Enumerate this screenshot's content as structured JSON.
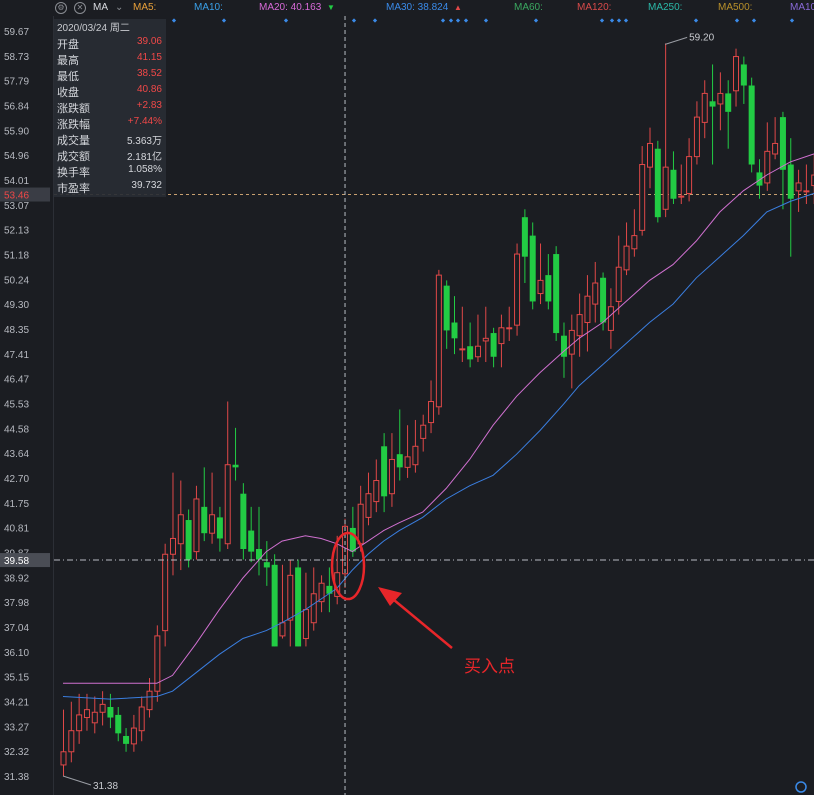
{
  "toolbar": {
    "settings_icon": "gear-icon",
    "close_icon": "close-icon",
    "indicator": "MA",
    "ma5": {
      "label": "MA5:",
      "color": "#e8a03a"
    },
    "ma10": {
      "label": "MA10:",
      "color": "#3aa0e8"
    },
    "ma20": {
      "label": "MA20: 40.163",
      "color": "#d86ad8"
    },
    "ma30": {
      "label": "MA30: 38.824",
      "color": "#3a8ae8"
    },
    "ma60": {
      "label": "MA60:",
      "color": "#3aa860"
    },
    "ma120": {
      "label": "MA120:",
      "color": "#d84a4a"
    },
    "ma250": {
      "label": "MA250:",
      "color": "#2ab8a8"
    },
    "ma500": {
      "label": "MA500:",
      "color": "#b8902a"
    },
    "ma_more": {
      "label": "MA10",
      "color": "#8a6ad8"
    }
  },
  "info_panel": {
    "date": "2020/03/24 周二",
    "rows": [
      {
        "label": "开盘",
        "value": "39.06",
        "tone": "up"
      },
      {
        "label": "最高",
        "value": "41.15",
        "tone": "up"
      },
      {
        "label": "最低",
        "value": "38.52",
        "tone": "up"
      },
      {
        "label": "收盘",
        "value": "40.86",
        "tone": "up"
      },
      {
        "label": "涨跌额",
        "value": "+2.83",
        "tone": "up"
      },
      {
        "label": "涨跌幅",
        "value": "+7.44%",
        "tone": "up"
      },
      {
        "label": "成交量",
        "value": "5.363万",
        "tone": "neu"
      },
      {
        "label": "成交额",
        "value": "2.181亿",
        "tone": "neu"
      },
      {
        "label": "换手率",
        "value": "1.058%",
        "tone": "neu"
      },
      {
        "label": "市盈率",
        "value": "39.732",
        "tone": "neu"
      }
    ]
  },
  "colors": {
    "background": "#1b1d22",
    "up": "#e04848",
    "down": "#22cc44",
    "ma20": "#d070d0",
    "ma30": "#3a7ee0",
    "crosshair": "#b8bcc4",
    "dash_price": "#c8a070",
    "annotation": "#e8262a"
  },
  "chart_data": {
    "type": "candlestick",
    "y_ticks": [
      "59.67",
      "58.73",
      "57.79",
      "56.84",
      "55.90",
      "54.96",
      "54.01",
      "53.07",
      "52.13",
      "51.18",
      "50.24",
      "49.30",
      "48.35",
      "47.41",
      "46.47",
      "45.53",
      "44.58",
      "43.64",
      "42.70",
      "41.75",
      "40.81",
      "39.87",
      "38.92",
      "37.98",
      "37.04",
      "36.10",
      "35.15",
      "34.21",
      "33.27",
      "32.32",
      "31.38"
    ],
    "ylim": [
      31.38,
      59.67
    ],
    "high_label": "59.20",
    "low_label": "31.38",
    "hline_price": {
      "value": 53.46,
      "label": "53.46"
    },
    "crosshair_price": {
      "value": 39.58,
      "label": "39.58"
    },
    "crosshair_index": 36,
    "annotation": "买入点",
    "candles": [
      {
        "o": 31.8,
        "c": 32.3,
        "h": 33.9,
        "l": 31.38
      },
      {
        "o": 32.3,
        "c": 33.1,
        "h": 34.2,
        "l": 31.9
      },
      {
        "o": 33.1,
        "c": 33.7,
        "h": 34.5,
        "l": 32.6
      },
      {
        "o": 33.6,
        "c": 33.9,
        "h": 34.5,
        "l": 33.1
      },
      {
        "o": 33.4,
        "c": 33.8,
        "h": 34.4,
        "l": 33.0
      },
      {
        "o": 33.8,
        "c": 34.1,
        "h": 34.6,
        "l": 33.3
      },
      {
        "o": 34.0,
        "c": 33.6,
        "h": 34.5,
        "l": 33.2
      },
      {
        "o": 33.7,
        "c": 33.0,
        "h": 34.0,
        "l": 32.7
      },
      {
        "o": 32.9,
        "c": 32.6,
        "h": 33.2,
        "l": 32.3
      },
      {
        "o": 32.6,
        "c": 33.2,
        "h": 33.7,
        "l": 32.3
      },
      {
        "o": 33.1,
        "c": 34.0,
        "h": 34.4,
        "l": 32.7
      },
      {
        "o": 33.9,
        "c": 34.6,
        "h": 35.1,
        "l": 33.6
      },
      {
        "o": 34.6,
        "c": 36.7,
        "h": 37.1,
        "l": 34.2
      },
      {
        "o": 36.9,
        "c": 39.8,
        "h": 40.2,
        "l": 36.3
      },
      {
        "o": 39.8,
        "c": 40.4,
        "h": 42.9,
        "l": 39.0
      },
      {
        "o": 40.2,
        "c": 41.3,
        "h": 42.6,
        "l": 39.2
      },
      {
        "o": 41.1,
        "c": 39.6,
        "h": 41.5,
        "l": 39.3
      },
      {
        "o": 39.9,
        "c": 41.9,
        "h": 42.4,
        "l": 39.6
      },
      {
        "o": 41.6,
        "c": 40.6,
        "h": 43.1,
        "l": 40.3
      },
      {
        "o": 40.6,
        "c": 41.3,
        "h": 42.9,
        "l": 40.2
      },
      {
        "o": 41.2,
        "c": 40.4,
        "h": 41.6,
        "l": 39.9
      },
      {
        "o": 40.2,
        "c": 43.2,
        "h": 45.6,
        "l": 40.0
      },
      {
        "o": 43.2,
        "c": 43.1,
        "h": 44.6,
        "l": 42.6
      },
      {
        "o": 42.1,
        "c": 40.0,
        "h": 42.5,
        "l": 39.6
      },
      {
        "o": 40.7,
        "c": 39.9,
        "h": 41.6,
        "l": 39.5
      },
      {
        "o": 40.0,
        "c": 39.6,
        "h": 41.6,
        "l": 39.0
      },
      {
        "o": 39.5,
        "c": 39.3,
        "h": 40.3,
        "l": 38.6
      },
      {
        "o": 39.4,
        "c": 36.3,
        "h": 39.8,
        "l": 36.3
      },
      {
        "o": 36.7,
        "c": 37.2,
        "h": 39.4,
        "l": 36.6
      },
      {
        "o": 37.3,
        "c": 39.0,
        "h": 39.6,
        "l": 36.3
      },
      {
        "o": 39.3,
        "c": 36.3,
        "h": 39.6,
        "l": 36.3
      },
      {
        "o": 36.6,
        "c": 37.7,
        "h": 39.1,
        "l": 36.3
      },
      {
        "o": 37.2,
        "c": 38.3,
        "h": 39.3,
        "l": 36.9
      },
      {
        "o": 38.0,
        "c": 38.7,
        "h": 39.0,
        "l": 37.6
      },
      {
        "o": 38.6,
        "c": 38.3,
        "h": 39.3,
        "l": 37.6
      },
      {
        "o": 38.2,
        "c": 39.1,
        "h": 40.5,
        "l": 37.9
      },
      {
        "o": 39.06,
        "c": 40.86,
        "h": 41.15,
        "l": 38.52
      },
      {
        "o": 40.8,
        "c": 39.9,
        "h": 41.6,
        "l": 39.7
      },
      {
        "o": 40.2,
        "c": 41.7,
        "h": 42.4,
        "l": 39.9
      },
      {
        "o": 41.2,
        "c": 42.1,
        "h": 42.9,
        "l": 40.9
      },
      {
        "o": 41.8,
        "c": 42.6,
        "h": 43.4,
        "l": 41.4
      },
      {
        "o": 43.9,
        "c": 42.0,
        "h": 44.4,
        "l": 41.4
      },
      {
        "o": 42.1,
        "c": 43.4,
        "h": 44.4,
        "l": 41.6
      },
      {
        "o": 43.6,
        "c": 43.1,
        "h": 45.3,
        "l": 42.6
      },
      {
        "o": 43.1,
        "c": 43.5,
        "h": 44.7,
        "l": 42.7
      },
      {
        "o": 43.2,
        "c": 43.9,
        "h": 44.9,
        "l": 42.9
      },
      {
        "o": 44.2,
        "c": 44.7,
        "h": 45.1,
        "l": 43.7
      },
      {
        "o": 44.8,
        "c": 45.6,
        "h": 46.4,
        "l": 44.4
      },
      {
        "o": 45.4,
        "c": 50.4,
        "h": 50.6,
        "l": 45.1
      },
      {
        "o": 50.0,
        "c": 48.3,
        "h": 50.2,
        "l": 47.6
      },
      {
        "o": 48.6,
        "c": 48.0,
        "h": 49.6,
        "l": 47.4
      },
      {
        "o": 47.6,
        "c": 47.6,
        "h": 49.2,
        "l": 47.1
      },
      {
        "o": 47.7,
        "c": 47.2,
        "h": 48.6,
        "l": 46.9
      },
      {
        "o": 47.3,
        "c": 47.7,
        "h": 48.9,
        "l": 47.1
      },
      {
        "o": 47.9,
        "c": 48.0,
        "h": 49.2,
        "l": 47.1
      },
      {
        "o": 48.2,
        "c": 47.3,
        "h": 48.4,
        "l": 46.9
      },
      {
        "o": 47.8,
        "c": 48.4,
        "h": 48.9,
        "l": 46.9
      },
      {
        "o": 48.4,
        "c": 48.4,
        "h": 49.2,
        "l": 47.9
      },
      {
        "o": 48.5,
        "c": 51.2,
        "h": 51.6,
        "l": 48.1
      },
      {
        "o": 52.6,
        "c": 51.1,
        "h": 52.9,
        "l": 50.1
      },
      {
        "o": 51.9,
        "c": 49.4,
        "h": 52.4,
        "l": 49.1
      },
      {
        "o": 49.7,
        "c": 50.2,
        "h": 51.6,
        "l": 49.3
      },
      {
        "o": 50.4,
        "c": 49.4,
        "h": 51.2,
        "l": 49.1
      },
      {
        "o": 51.2,
        "c": 48.2,
        "h": 51.5,
        "l": 47.9
      },
      {
        "o": 48.1,
        "c": 47.3,
        "h": 48.6,
        "l": 46.5
      },
      {
        "o": 47.4,
        "c": 48.3,
        "h": 48.9,
        "l": 46.1
      },
      {
        "o": 48.1,
        "c": 48.9,
        "h": 49.7,
        "l": 47.3
      },
      {
        "o": 48.6,
        "c": 49.6,
        "h": 50.4,
        "l": 47.5
      },
      {
        "o": 49.3,
        "c": 50.1,
        "h": 50.9,
        "l": 48.6
      },
      {
        "o": 50.3,
        "c": 48.6,
        "h": 50.5,
        "l": 48.3
      },
      {
        "o": 48.3,
        "c": 49.2,
        "h": 49.9,
        "l": 47.6
      },
      {
        "o": 49.4,
        "c": 50.7,
        "h": 51.9,
        "l": 48.9
      },
      {
        "o": 50.6,
        "c": 51.5,
        "h": 52.4,
        "l": 50.4
      },
      {
        "o": 51.4,
        "c": 51.9,
        "h": 52.9,
        "l": 51.1
      },
      {
        "o": 52.1,
        "c": 54.6,
        "h": 55.3,
        "l": 51.9
      },
      {
        "o": 54.5,
        "c": 55.4,
        "h": 56.0,
        "l": 53.7
      },
      {
        "o": 55.2,
        "c": 52.6,
        "h": 55.5,
        "l": 52.4
      },
      {
        "o": 52.9,
        "c": 54.5,
        "h": 59.2,
        "l": 52.6
      },
      {
        "o": 54.4,
        "c": 53.3,
        "h": 55.1,
        "l": 53.1
      },
      {
        "o": 53.4,
        "c": 53.4,
        "h": 54.6,
        "l": 53.1
      },
      {
        "o": 53.5,
        "c": 54.9,
        "h": 55.6,
        "l": 53.2
      },
      {
        "o": 54.9,
        "c": 56.4,
        "h": 57.0,
        "l": 54.6
      },
      {
        "o": 56.2,
        "c": 57.3,
        "h": 57.8,
        "l": 55.6
      },
      {
        "o": 57.0,
        "c": 56.8,
        "h": 58.4,
        "l": 54.6
      },
      {
        "o": 56.9,
        "c": 57.3,
        "h": 58.1,
        "l": 55.9
      },
      {
        "o": 57.3,
        "c": 56.6,
        "h": 57.8,
        "l": 55.2
      },
      {
        "o": 57.4,
        "c": 58.7,
        "h": 59.0,
        "l": 56.8
      },
      {
        "o": 58.4,
        "c": 57.6,
        "h": 58.7,
        "l": 56.9
      },
      {
        "o": 57.6,
        "c": 54.6,
        "h": 57.9,
        "l": 54.3
      },
      {
        "o": 54.3,
        "c": 53.8,
        "h": 54.8,
        "l": 53.3
      },
      {
        "o": 53.9,
        "c": 55.1,
        "h": 56.2,
        "l": 53.6
      },
      {
        "o": 55.0,
        "c": 55.4,
        "h": 56.4,
        "l": 54.8
      },
      {
        "o": 56.4,
        "c": 54.4,
        "h": 56.6,
        "l": 52.9
      },
      {
        "o": 54.6,
        "c": 53.3,
        "h": 55.6,
        "l": 51.1
      },
      {
        "o": 53.6,
        "c": 53.9,
        "h": 54.4,
        "l": 52.8
      },
      {
        "o": 53.6,
        "c": 53.6,
        "h": 54.6,
        "l": 53.1
      },
      {
        "o": 53.8,
        "c": 54.2,
        "h": 55.0,
        "l": 53.1
      },
      {
        "o": 53.2,
        "c": 53.8,
        "h": 54.4,
        "l": 52.6
      },
      {
        "o": 53.8,
        "c": 53.0,
        "h": 54.1,
        "l": 52.4
      }
    ],
    "ma20_points": [
      [
        0,
        34.9
      ],
      [
        6,
        34.9
      ],
      [
        12,
        34.9
      ],
      [
        14,
        35.2
      ],
      [
        17,
        36.4
      ],
      [
        20,
        37.7
      ],
      [
        23,
        38.9
      ],
      [
        26,
        39.9
      ],
      [
        28,
        40.3
      ],
      [
        31,
        40.5
      ],
      [
        33,
        40.4
      ],
      [
        35,
        40.2
      ],
      [
        37,
        39.9
      ],
      [
        39,
        40.3
      ],
      [
        41,
        40.7
      ],
      [
        43,
        41.0
      ],
      [
        46,
        41.4
      ],
      [
        49,
        42.3
      ],
      [
        52,
        43.4
      ],
      [
        55,
        44.7
      ],
      [
        58,
        45.8
      ],
      [
        61,
        46.7
      ],
      [
        64,
        47.5
      ],
      [
        66,
        48.0
      ],
      [
        69,
        48.6
      ],
      [
        72,
        49.4
      ],
      [
        75,
        50.2
      ],
      [
        78,
        50.8
      ],
      [
        81,
        51.7
      ],
      [
        84,
        52.8
      ],
      [
        87,
        53.6
      ],
      [
        90,
        54.2
      ],
      [
        93,
        54.7
      ],
      [
        96,
        55.0
      ],
      [
        98,
        55.2
      ]
    ],
    "ma30_points": [
      [
        0,
        34.4
      ],
      [
        6,
        34.3
      ],
      [
        12,
        34.4
      ],
      [
        14,
        34.6
      ],
      [
        17,
        35.3
      ],
      [
        20,
        36.0
      ],
      [
        23,
        36.6
      ],
      [
        26,
        36.9
      ],
      [
        28,
        37.2
      ],
      [
        31,
        37.7
      ],
      [
        33,
        38.1
      ],
      [
        35,
        38.5
      ],
      [
        37,
        39.2
      ],
      [
        39,
        39.8
      ],
      [
        41,
        40.3
      ],
      [
        43,
        40.7
      ],
      [
        46,
        41.2
      ],
      [
        49,
        41.9
      ],
      [
        52,
        42.4
      ],
      [
        55,
        42.8
      ],
      [
        58,
        43.6
      ],
      [
        61,
        44.5
      ],
      [
        64,
        45.5
      ],
      [
        66,
        46.2
      ],
      [
        69,
        47.0
      ],
      [
        72,
        47.8
      ],
      [
        75,
        48.6
      ],
      [
        78,
        49.3
      ],
      [
        81,
        50.3
      ],
      [
        84,
        51.1
      ],
      [
        87,
        51.9
      ],
      [
        90,
        52.8
      ],
      [
        93,
        53.2
      ],
      [
        96,
        53.5
      ],
      [
        98,
        53.6
      ]
    ]
  }
}
